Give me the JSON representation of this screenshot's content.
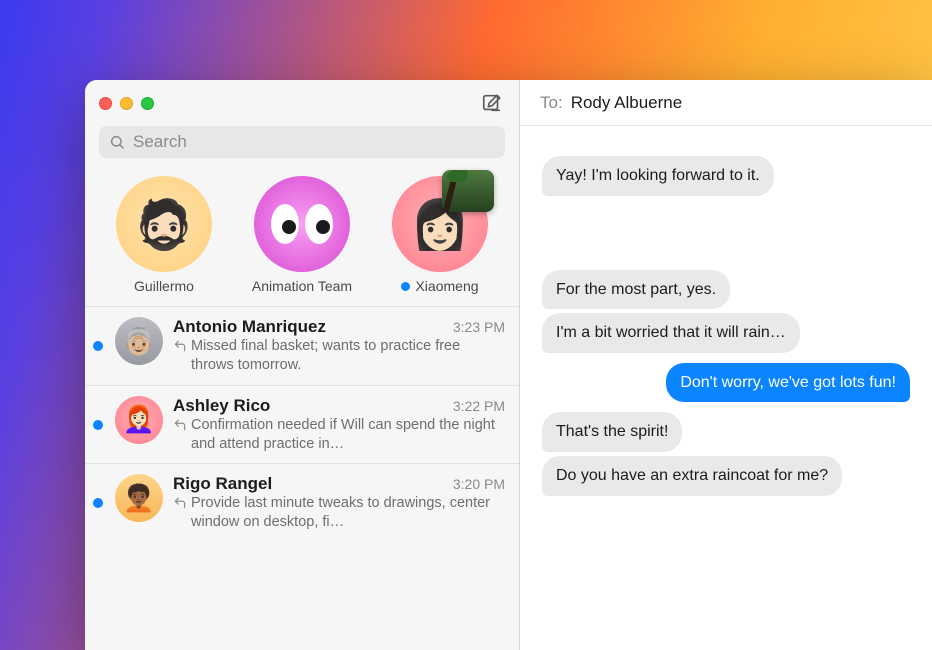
{
  "search": {
    "placeholder": "Search"
  },
  "pins": [
    {
      "label": "Guillermo",
      "unread": false,
      "avatar_class": "av-g1",
      "face": "🧔🏻"
    },
    {
      "label": "Animation Team",
      "unread": false,
      "avatar_class": "av-g2",
      "eyes": true
    },
    {
      "label": "Xiaomeng",
      "unread": true,
      "avatar_class": "av-g3",
      "face": "👩🏻",
      "thumb": true
    }
  ],
  "conversations": [
    {
      "name": "Antonio Manriquez",
      "time": "3:23 PM",
      "unread": true,
      "avatar_class": "av-s1",
      "face": "👵🏼",
      "preview": "Missed final basket; wants to practice free throws tomorrow."
    },
    {
      "name": "Ashley Rico",
      "time": "3:22 PM",
      "unread": true,
      "avatar_class": "av-s2",
      "face": "👩🏻‍🦰",
      "preview": "Confirmation needed if Will can spend the night and attend practice in…"
    },
    {
      "name": "Rigo Rangel",
      "time": "3:20 PM",
      "unread": true,
      "avatar_class": "av-s3",
      "face": "🧑🏾‍🦱",
      "preview": "Provide last minute tweaks to drawings, center window on desktop, fi…"
    }
  ],
  "to": {
    "label": "To:",
    "name": "Rody Albuerne"
  },
  "messages": [
    {
      "dir": "in",
      "text": "Yay! I'm looking forward to it."
    },
    {
      "gap": true
    },
    {
      "dir": "in",
      "text": "For the most part, yes."
    },
    {
      "dir": "in",
      "text": "I'm a bit worried that it will rain…"
    },
    {
      "dir": "out",
      "text": "Don't worry, we've got lots fun!"
    },
    {
      "dir": "in",
      "text": "That's the spirit!"
    },
    {
      "dir": "in",
      "text": "Do you have an extra raincoat for me?"
    }
  ]
}
